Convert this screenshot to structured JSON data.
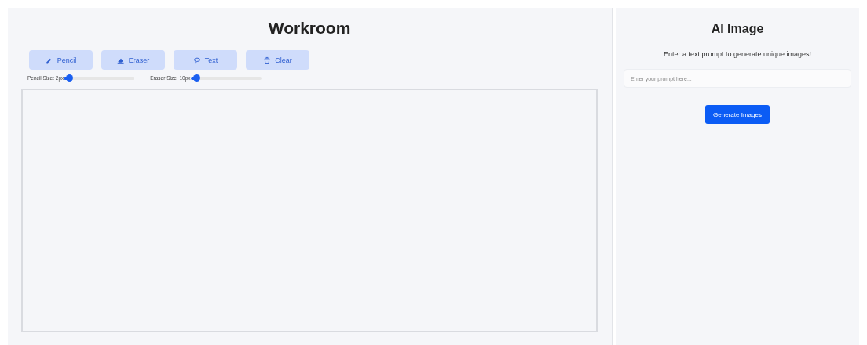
{
  "workroom": {
    "title": "Workroom",
    "tools": [
      {
        "kind": "pencil",
        "label": "Pencil"
      },
      {
        "kind": "eraser",
        "label": "Eraser"
      },
      {
        "kind": "text",
        "label": "Text"
      },
      {
        "kind": "clear",
        "label": "Clear"
      }
    ],
    "sliders": [
      {
        "label": "Pencil Size: 2px",
        "level": 0.08
      },
      {
        "label": "Eraser Size: 10px",
        "level": 0.08
      }
    ]
  },
  "ai_image": {
    "title": "AI Image",
    "subtitle": "Enter a text prompt to generate unique images!",
    "prompt": {
      "placeholder": "Enter your prompt here..."
    },
    "button": "Generate Images"
  }
}
